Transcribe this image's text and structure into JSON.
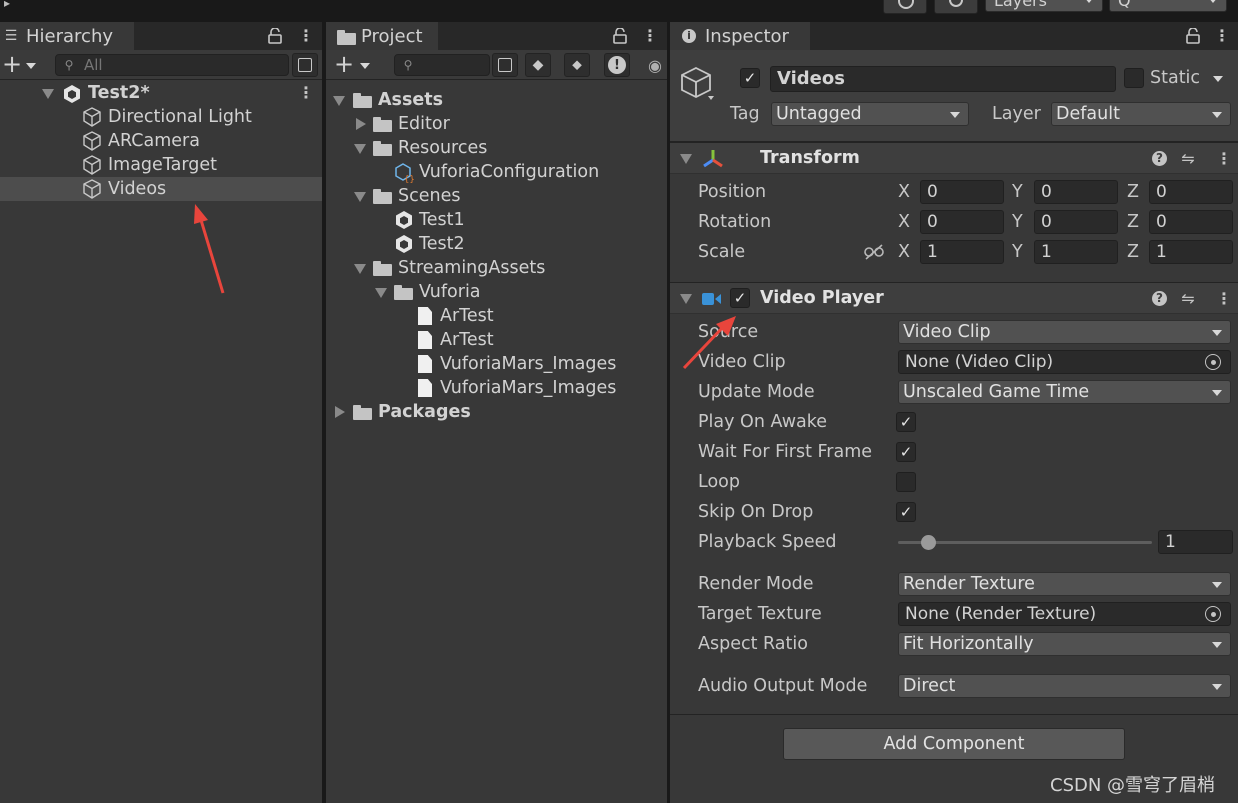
{
  "toolbar": {
    "layers_label": "Layers",
    "layout_label": "Q"
  },
  "hierarchy": {
    "tab_label": "Hierarchy",
    "search_placeholder": "All",
    "scene": "Test2*",
    "items": [
      "Directional Light",
      "ARCamera",
      "ImageTarget",
      "Videos"
    ],
    "selected": "Videos"
  },
  "project": {
    "tab_label": "Project",
    "tree": {
      "assets": "Assets",
      "editor": "Editor",
      "resources": "Resources",
      "vuforia_configuration": "VuforiaConfiguration",
      "scenes": "Scenes",
      "test1": "Test1",
      "test2": "Test2",
      "streaming_assets": "StreamingAssets",
      "vuforia": "Vuforia",
      "files": [
        "ArTest",
        "ArTest",
        "VuforiaMars_Images",
        "VuforiaMars_Images"
      ],
      "packages": "Packages"
    }
  },
  "inspector": {
    "tab_label": "Inspector",
    "object_name": "Videos",
    "object_active": true,
    "static_label": "Static",
    "tag_label": "Tag",
    "tag_value": "Untagged",
    "layer_label": "Layer",
    "layer_value": "Default",
    "transform": {
      "title": "Transform",
      "position_label": "Position",
      "rotation_label": "Rotation",
      "scale_label": "Scale",
      "x_label": "X",
      "y_label": "Y",
      "z_label": "Z",
      "position": [
        "0",
        "0",
        "0"
      ],
      "rotation": [
        "0",
        "0",
        "0"
      ],
      "scale": [
        "1",
        "1",
        "1"
      ]
    },
    "video_player": {
      "title": "Video Player",
      "enabled": true,
      "source_label": "Source",
      "source_value": "Video Clip",
      "video_clip_label": "Video Clip",
      "video_clip_value": "None (Video Clip)",
      "update_mode_label": "Update Mode",
      "update_mode_value": "Unscaled Game Time",
      "play_on_awake_label": "Play On Awake",
      "play_on_awake": true,
      "wait_first_frame_label": "Wait For First Frame",
      "wait_first_frame": true,
      "loop_label": "Loop",
      "loop": false,
      "skip_on_drop_label": "Skip On Drop",
      "skip_on_drop": true,
      "playback_speed_label": "Playback Speed",
      "playback_speed_value": "1",
      "playback_speed_slider_fraction": 0.12,
      "render_mode_label": "Render Mode",
      "render_mode_value": "Render Texture",
      "target_texture_label": "Target Texture",
      "target_texture_value": "None (Render Texture)",
      "aspect_ratio_label": "Aspect Ratio",
      "aspect_ratio_value": "Fit Horizontally",
      "audio_output_label": "Audio Output Mode",
      "audio_output_value": "Direct"
    },
    "add_component_label": "Add Component"
  },
  "watermark": "CSDN @雪穹了眉梢",
  "colors": {
    "panel_bg": "#383838",
    "selection": "#4d4d4d",
    "arrow_red": "#e8453c",
    "transform_icon_blue": "#4c8cf5",
    "video_icon_blue": "#3a92d8"
  }
}
